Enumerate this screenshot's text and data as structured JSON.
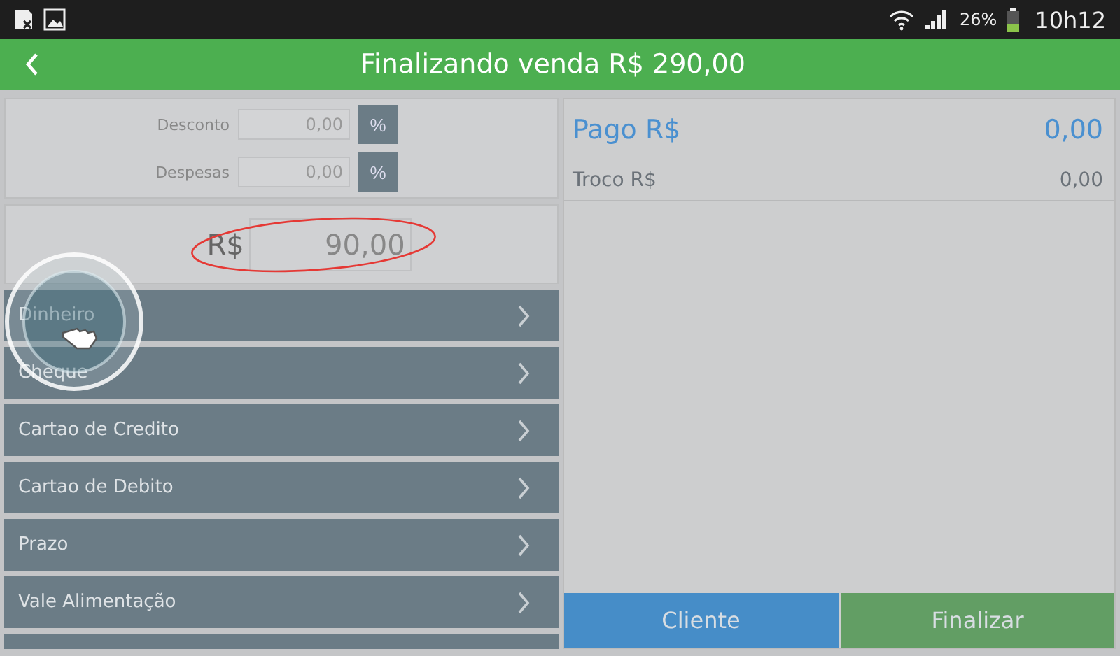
{
  "status_bar": {
    "battery": "26%",
    "time": "10h12"
  },
  "header": {
    "title": "Finalizando venda R$ 290,00"
  },
  "adjustments": [
    {
      "label": "Desconto",
      "value": "0,00",
      "unit": "%"
    },
    {
      "label": "Despesas",
      "value": "0,00",
      "unit": "%"
    }
  ],
  "amount": {
    "currency": "R$",
    "value": "90,00"
  },
  "payment_methods": [
    {
      "label": "Dinheiro",
      "touched": true
    },
    {
      "label": "Cheque",
      "touched": false
    },
    {
      "label": "Cartao de Credito",
      "touched": false
    },
    {
      "label": "Cartao de Debito",
      "touched": false
    },
    {
      "label": "Prazo",
      "touched": false
    },
    {
      "label": "Vale Alimentação",
      "touched": false
    }
  ],
  "summary": [
    {
      "label": "Pago R$",
      "value": "0,00",
      "kind": "main"
    },
    {
      "label": "Troco R$",
      "value": "0,00",
      "kind": "sub"
    }
  ],
  "buttons": [
    {
      "label": "Cliente",
      "kind": "client"
    },
    {
      "label": "Finalizar",
      "kind": "finish"
    }
  ]
}
